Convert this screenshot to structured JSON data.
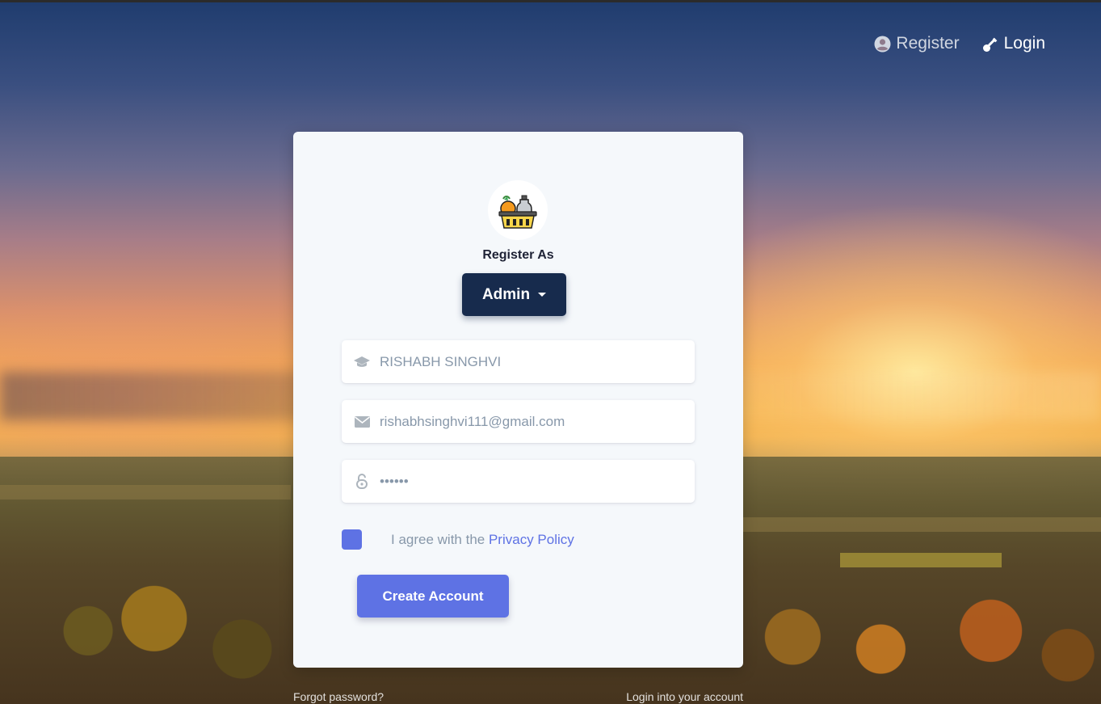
{
  "nav": {
    "register_label": "Register",
    "login_label": "Login",
    "register_icon": "user-circle-icon",
    "login_icon": "key-icon"
  },
  "card": {
    "logo_icon": "grocery-basket-icon",
    "register_as_label": "Register As",
    "role_selected": "Admin"
  },
  "form": {
    "name_value": "RISHABH SINGHVI",
    "name_icon": "graduation-cap-icon",
    "email_value": "rishabhsinghvi111@gmail.com",
    "email_icon": "envelope-icon",
    "password_value": "••••••",
    "password_icon": "lock-open-icon",
    "agree_prefix": "I agree with the ",
    "privacy_link": "Privacy Policy",
    "submit_label": "Create Account"
  },
  "footer": {
    "forgot_password": "Forgot password?",
    "login_link": "Login into your account"
  },
  "colors": {
    "primary": "#5e72e4",
    "dark": "#172b4d",
    "muted_text": "#8898aa"
  }
}
